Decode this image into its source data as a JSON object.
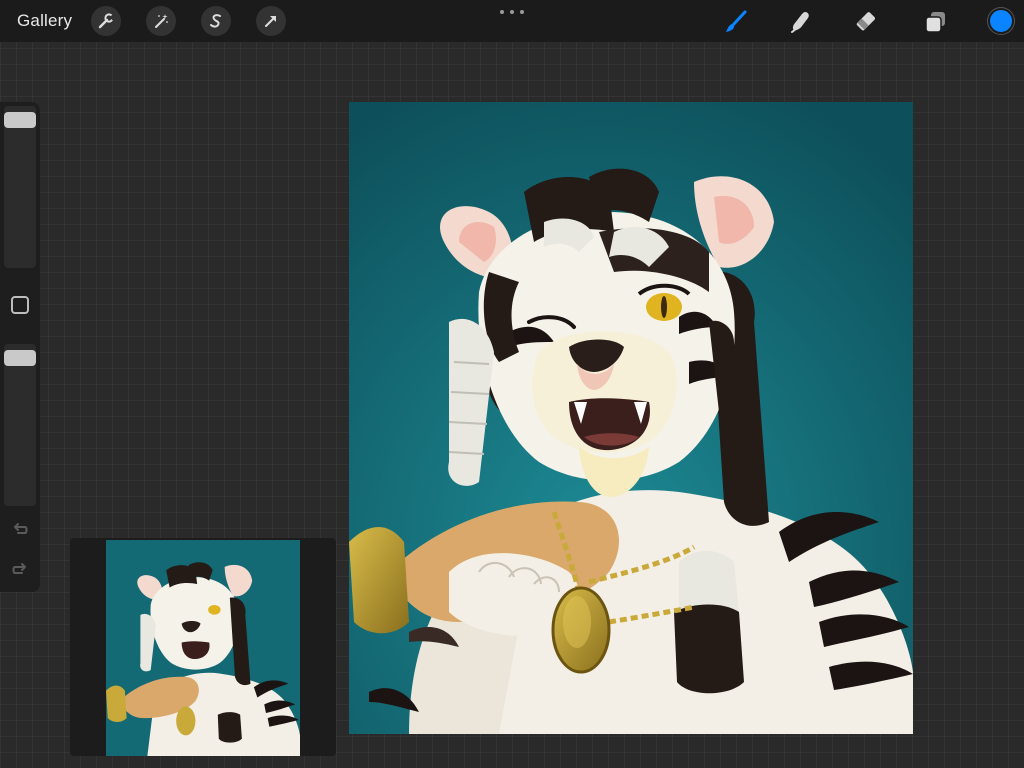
{
  "app": {
    "gallery_label": "Gallery"
  },
  "toolbar": {
    "left_tools": [
      {
        "name": "actions",
        "icon": "wrench-icon"
      },
      {
        "name": "adjustments",
        "icon": "magic-wand-icon"
      },
      {
        "name": "selection",
        "icon": "selection-s-icon"
      },
      {
        "name": "transform",
        "icon": "arrow-cursor-icon"
      }
    ],
    "right_tools": [
      {
        "name": "brush",
        "icon": "brush-icon",
        "active": true
      },
      {
        "name": "smudge",
        "icon": "smudge-finger-icon",
        "active": false
      },
      {
        "name": "eraser",
        "icon": "eraser-icon",
        "active": false
      },
      {
        "name": "layers",
        "icon": "layers-icon",
        "active": false
      }
    ],
    "more_icon": "ellipsis-icon",
    "current_color": "#0a84ff"
  },
  "sidebar": {
    "brush_size_level": 0.96,
    "opacity_level": 0.96,
    "modify_icon": "square-icon",
    "undo_icon": "undo-arrow-icon",
    "redo_icon": "redo-arrow-icon"
  },
  "colors": {
    "accent": "#0a84ff",
    "toolbar_bg": "#1b1b1b",
    "workspace_bg": "#2a2a2a",
    "canvas_bg": "#0f5964"
  },
  "canvas": {
    "artwork": "white-tiger-portrait"
  },
  "reference": {
    "artwork": "white-tiger-portrait-thumbnail"
  }
}
